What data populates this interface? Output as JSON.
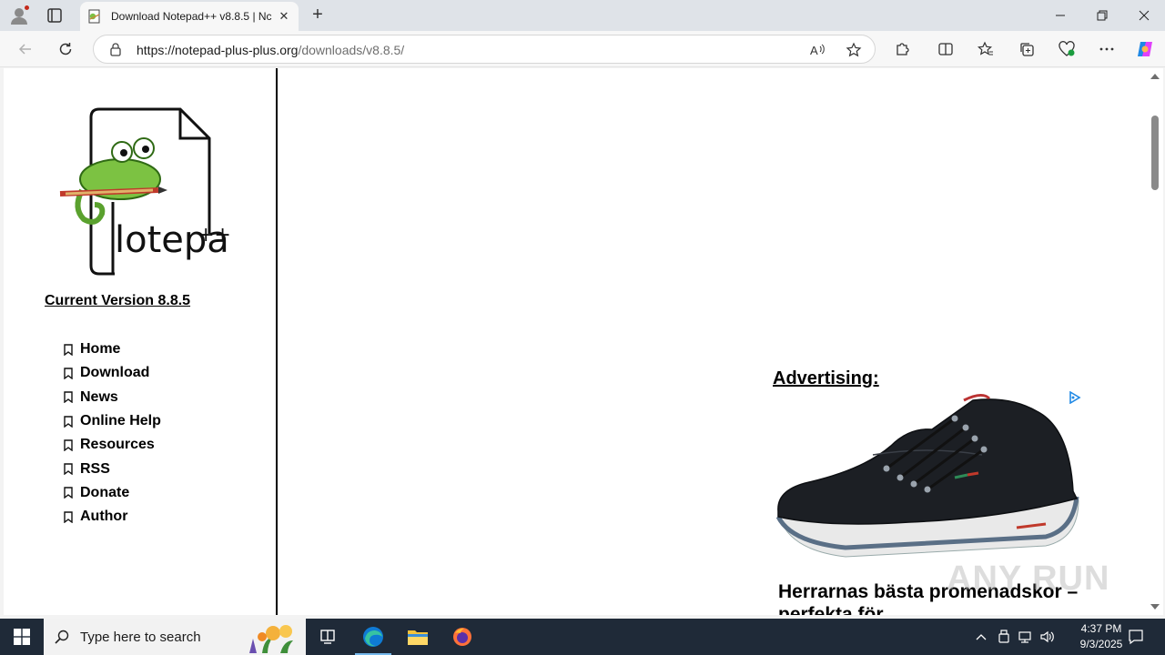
{
  "browser": {
    "tab_title": "Download Notepad++ v8.8.5 | Nc",
    "url_host": "https://notepad-plus-plus.org",
    "url_path": "/downloads/v8.8.5/"
  },
  "sidebar": {
    "current_version": "Current Version 8.8.5",
    "nav_items": [
      "Home",
      "Download",
      "News",
      "Online Help",
      "Resources",
      "RSS",
      "Donate",
      "Author"
    ]
  },
  "advertising": {
    "heading": "Advertising:",
    "ad_title": "Herrarnas bästa promenadskor – perfekta för"
  },
  "watermark": "ANY RUN",
  "taskbar": {
    "search_placeholder": "Type here to search",
    "time": "4:37 PM",
    "date": "9/3/2025"
  },
  "colors": {
    "taskbar": "#1f2a38",
    "tabstrip": "#dfe3e8",
    "edge_blue": "#0f7bd4"
  }
}
